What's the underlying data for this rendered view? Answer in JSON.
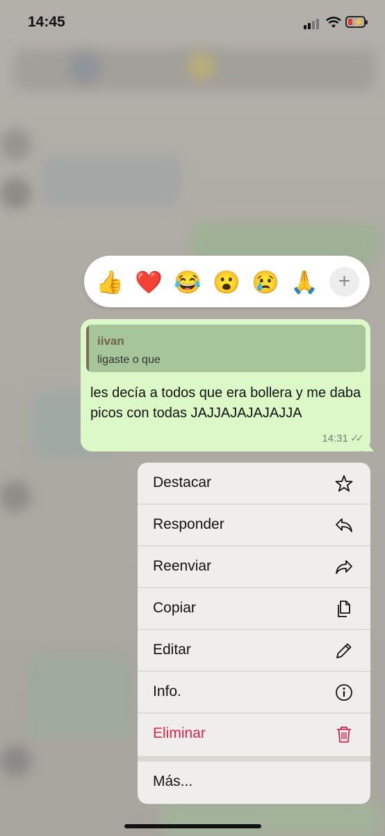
{
  "status_bar": {
    "time": "14:45"
  },
  "reactions": {
    "emojis": [
      "👍",
      "❤️",
      "😂",
      "😮",
      "😢",
      "🙏"
    ],
    "more_symbol": "+"
  },
  "message": {
    "quoted_author": "iivan",
    "quoted_text": "ligaste o que",
    "text": "les decía a todos que era bollera y me daba picos con todas JAJJAJAJAJAJJA",
    "time": "14:31",
    "ticks": "✓✓"
  },
  "menu": {
    "items": [
      {
        "label": "Destacar",
        "icon": "star-icon"
      },
      {
        "label": "Responder",
        "icon": "reply-icon"
      },
      {
        "label": "Reenviar",
        "icon": "forward-icon"
      },
      {
        "label": "Copiar",
        "icon": "copy-icon"
      },
      {
        "label": "Editar",
        "icon": "pencil-icon"
      },
      {
        "label": "Info.",
        "icon": "info-icon"
      },
      {
        "label": "Eliminar",
        "icon": "trash-icon"
      }
    ],
    "more_label": "Más..."
  },
  "colors": {
    "bubble": "#dbf8c6",
    "danger": "#d6254b",
    "menu_bg": "#efeeed"
  }
}
